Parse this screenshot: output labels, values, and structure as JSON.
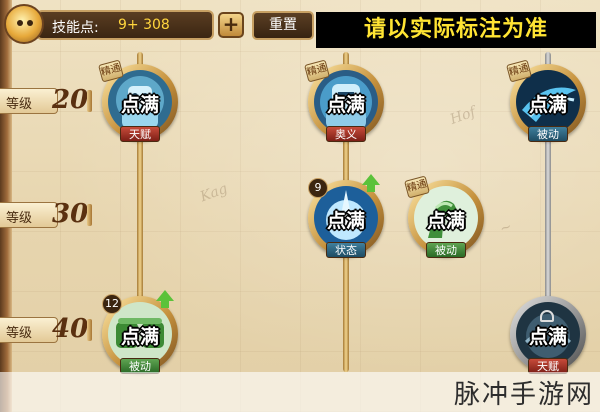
{
  "header": {
    "points_label": "技能点:",
    "points_value": "9+ 308",
    "plus_label": "+",
    "reset_label": "重置",
    "notice": "请以实际标注为准"
  },
  "levels": [
    {
      "label": "等级",
      "value": "20"
    },
    {
      "label": "等级",
      "value": "30"
    },
    {
      "label": "等级",
      "value": "40"
    }
  ],
  "skills": [
    {
      "status": "点满",
      "tag": "精通",
      "type": "天赋",
      "banner_color": "red"
    },
    {
      "status": "点满",
      "tag": "精通",
      "type": "奥义",
      "banner_color": "red"
    },
    {
      "status": "点满",
      "tag": "精通",
      "type": "被动",
      "banner_color": "blue"
    },
    {
      "status": "点满",
      "count": "9",
      "type": "状态",
      "banner_color": "blue",
      "upgradable": true
    },
    {
      "status": "点满",
      "tag": "精通",
      "type": "被动",
      "banner_color": "green"
    },
    {
      "status": "点满",
      "count": "12",
      "type": "被动",
      "banner_color": "green",
      "upgradable": true
    },
    {
      "status": "点满",
      "type": "天赋",
      "banner_color": "red",
      "locked": true
    }
  ],
  "watermark": "脉冲手游网"
}
